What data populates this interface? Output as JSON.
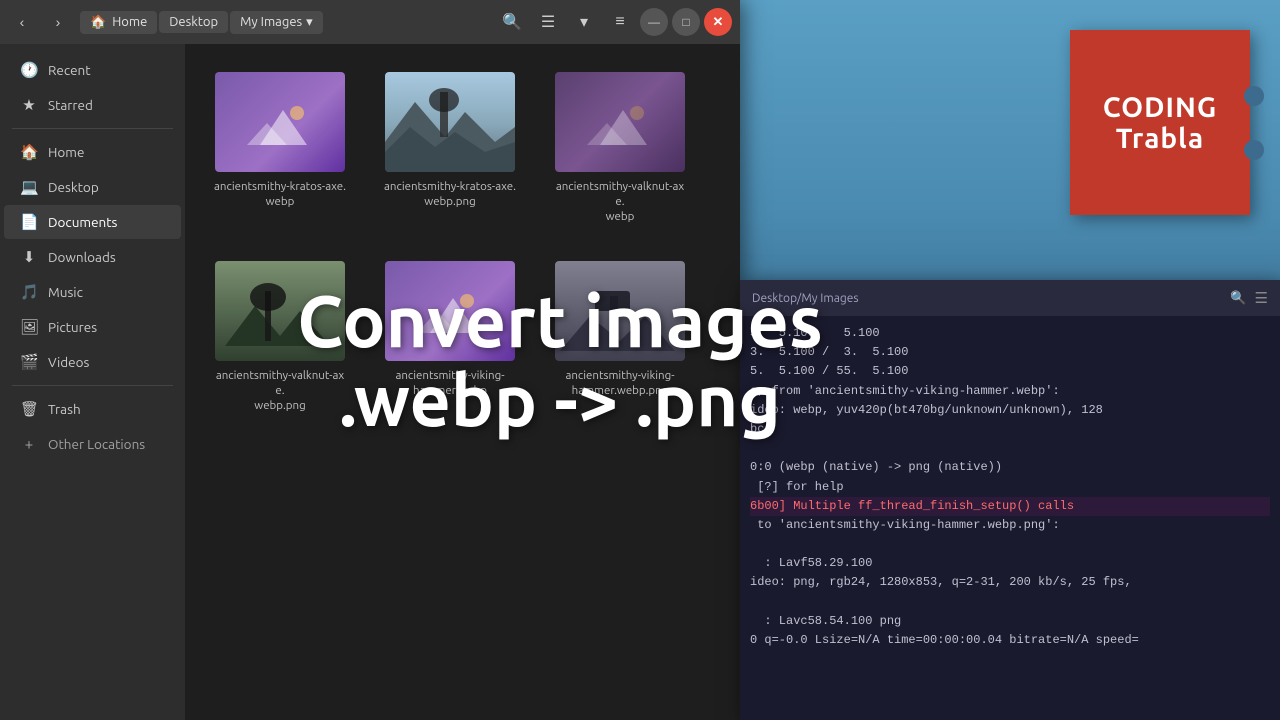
{
  "background": {
    "color": "#3d6b8e"
  },
  "file_manager": {
    "title_bar": {
      "nav_back_label": "‹",
      "nav_forward_label": "›",
      "breadcrumbs": [
        "Home",
        "Desktop",
        "My Images"
      ],
      "search_icon": "🔍",
      "view_icon": "☰",
      "view_dropdown_icon": "▾",
      "menu_icon": "≡",
      "minimize_icon": "—",
      "maximize_icon": "□",
      "close_icon": "✕"
    },
    "sidebar": {
      "items": [
        {
          "id": "recent",
          "label": "Recent",
          "icon": "🕐"
        },
        {
          "id": "starred",
          "label": "Starred",
          "icon": "★"
        },
        {
          "id": "home",
          "label": "Home",
          "icon": "🏠"
        },
        {
          "id": "desktop",
          "label": "Desktop",
          "icon": "💻"
        },
        {
          "id": "documents",
          "label": "Documents",
          "icon": "📄"
        },
        {
          "id": "downloads",
          "label": "Downloads",
          "icon": "⬇"
        },
        {
          "id": "music",
          "label": "Music",
          "icon": "🎵"
        },
        {
          "id": "pictures",
          "label": "Pictures",
          "icon": "🖼"
        },
        {
          "id": "videos",
          "label": "Videos",
          "icon": "🎬"
        },
        {
          "id": "trash",
          "label": "Trash",
          "icon": "🗑"
        }
      ],
      "other_locations_label": "Other Locations",
      "other_locations_icon": "+"
    },
    "files": [
      {
        "id": "file1",
        "name": "ancientsmithy-kratos-axe.webp",
        "type": "webp_placeholder"
      },
      {
        "id": "file2",
        "name": "ancientsmithy-kratos-axe.webp.png",
        "type": "photo_kratos"
      },
      {
        "id": "file3",
        "name": "ancientsmithy-valknut-axe.webp",
        "type": "webp_dark"
      },
      {
        "id": "file4",
        "name": "ancientsmithy-valknut-axe.webp.png",
        "type": "photo_valknut"
      },
      {
        "id": "file5",
        "name": "ancientsmithy-viking-hammer.webp",
        "type": "webp_placeholder"
      },
      {
        "id": "file6",
        "name": "ancientsmithy-viking-hammer.webp.png",
        "type": "photo_hammer"
      }
    ]
  },
  "overlay": {
    "line1": "Convert images",
    "line2": ".webp -> .png"
  },
  "terminal": {
    "title": "Desktop/My Images",
    "lines": [
      {
        "text": "5.  5.100    5.100",
        "type": "normal"
      },
      {
        "text": "3.  5.100 /  3.  5.100",
        "type": "normal"
      },
      {
        "text": "5.  5.100 / 55.  5.100",
        "type": "normal"
      },
      {
        "text": "e, from 'ancientsmithy-viking-hammer.webp':",
        "type": "normal"
      },
      {
        "text": "ideo: webp, yuv420p(bt470bg/unknown/unknown), 128",
        "type": "normal"
      },
      {
        "text": "bc",
        "type": "normal"
      },
      {
        "text": "",
        "type": "normal"
      },
      {
        "text": "0:0 (webp (native) -> png (native))",
        "type": "normal"
      },
      {
        "text": " [?] for help",
        "type": "normal"
      },
      {
        "text": "6b00] Multiple ff_thread_finish_setup() calls",
        "type": "highlight"
      },
      {
        "text": " to 'ancientsmithy-viking-hammer.webp.png':",
        "type": "normal"
      },
      {
        "text": "",
        "type": "normal"
      },
      {
        "text": "  : Lavf58.29.100",
        "type": "normal"
      },
      {
        "text": "ideo: png, rgb24, 1280x853, q=2-31, 200 kb/s, 25 fps,",
        "type": "normal"
      },
      {
        "text": "",
        "type": "normal"
      },
      {
        "text": "  : Lavc58.54.100 png",
        "type": "normal"
      },
      {
        "text": "0 q=-0.0 Lsize=N/A time=00:00:00.04 bitrate=N/A speed=",
        "type": "normal"
      }
    ]
  },
  "logo": {
    "line1": "CODING",
    "line2": "Trabla"
  }
}
